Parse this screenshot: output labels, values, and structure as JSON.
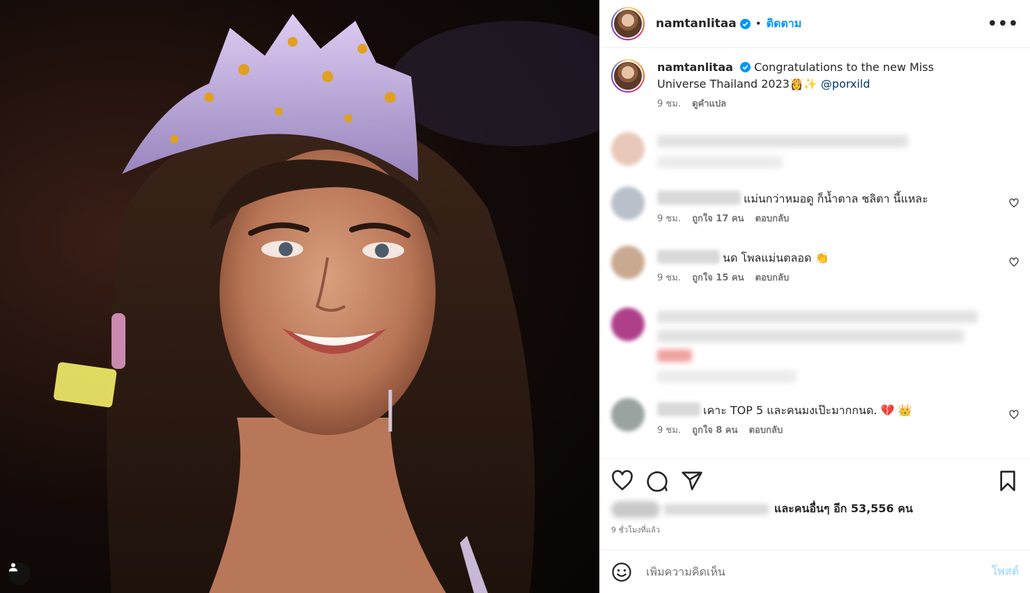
{
  "post": {
    "username": "namtanlitaa",
    "follow_label": "ติดตาม",
    "more_label": "•••",
    "caption_text": "Congratulations to the new Miss Universe Thailand 2023",
    "caption_emojis": "👸✨",
    "caption_mention": "@porxild",
    "caption_time": "9 ชม.",
    "translate_label": "ดูคำแปล"
  },
  "comments": [
    {
      "text": "แม่นกว่าหมอดู ก็น้ำตาล ชลิตา นี้แหละ",
      "time": "9 ชม.",
      "likes": "ถูกใจ 17 คน",
      "reply": "ตอบกลับ"
    },
    {
      "text": "นด โพลแม่นตลอด 👏",
      "time": "9 ชม.",
      "likes": "ถูกใจ 15 คน",
      "reply": "ตอบกลับ"
    },
    {
      "text": "เคาะ TOP 5 และคนมงเป๊ะมากกนด. 💔 👑",
      "time": "9 ชม.",
      "likes": "ถูกใจ 8 คน",
      "reply": "ตอบกลับ"
    }
  ],
  "likes_text": "และคนอื่นๆ อีก 53,556 คน",
  "posted_ago": "9 ชั่วโมงที่แล้ว",
  "comment_input": {
    "placeholder": "เพิ่มความคิดเห็น",
    "post_label": "โพสต์"
  },
  "colors": {
    "accent": "#0095f6",
    "text": "#262626",
    "muted": "#737373"
  }
}
